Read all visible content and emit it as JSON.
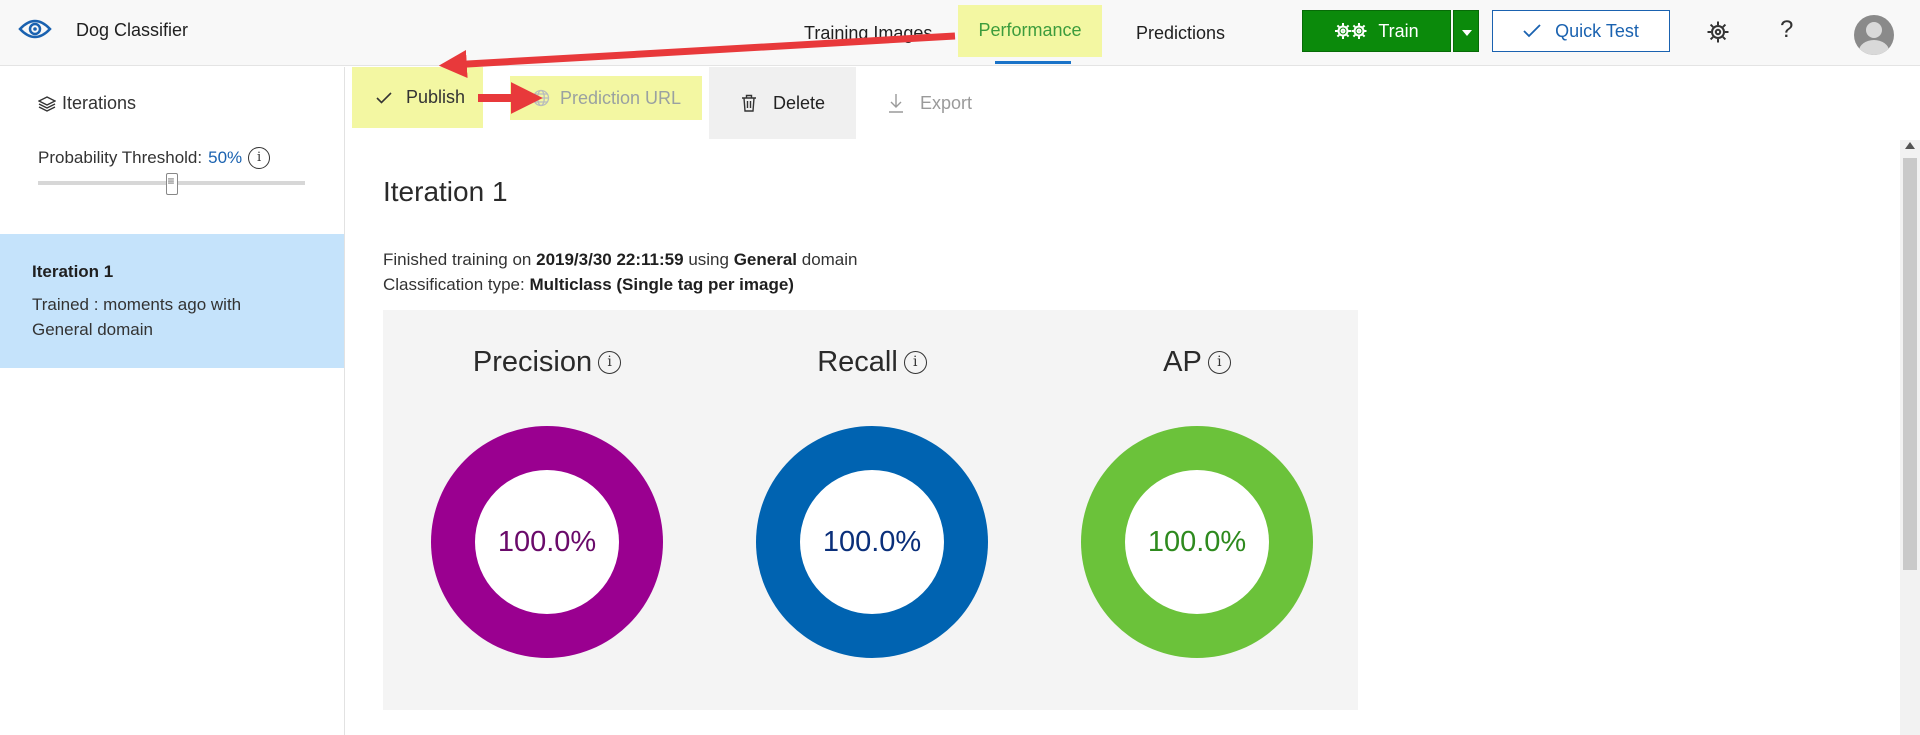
{
  "app": {
    "title": "Dog Classifier"
  },
  "nav": {
    "items": [
      {
        "label": "Training Images"
      },
      {
        "label": "Performance"
      },
      {
        "label": "Predictions"
      }
    ]
  },
  "actions": {
    "train_label": "Train",
    "quick_test_label": "Quick Test",
    "help_label": "?"
  },
  "sidebar": {
    "iterations_label": "Iterations",
    "threshold_label": "Probability Threshold:",
    "threshold_value": "50%",
    "threshold_fraction": 0.5,
    "iteration_card": {
      "title": "Iteration 1",
      "subtitle": "Trained : moments ago with General domain"
    }
  },
  "toolbar": {
    "publish_label": "Publish",
    "prediction_url_label": "Prediction URL",
    "delete_label": "Delete",
    "export_label": "Export"
  },
  "main": {
    "title": "Iteration 1",
    "finished_prefix": "Finished training on",
    "finished_date": "2019/3/30 22:11:59",
    "finished_using": "using",
    "domain": "General",
    "domain_suffix": "domain",
    "classification_prefix": "Classification type:",
    "classification_value": "Multiclass (Single tag per image)"
  },
  "metrics": [
    {
      "label": "Precision",
      "value": "100.0%",
      "ring_color": "#9a0090",
      "text_color": "#6a0a6a"
    },
    {
      "label": "Recall",
      "value": "100.0%",
      "ring_color": "#0063b1",
      "text_color": "#0a2f7a"
    },
    {
      "label": "AP",
      "value": "100.0%",
      "ring_color": "#6bc23a",
      "text_color": "#2e8a1e"
    }
  ],
  "colors": {
    "highlight": "#f3f7a2",
    "train_green": "#0b8a0b",
    "accent_blue": "#1a62b0",
    "selected_card": "#c5e3fb",
    "annotation_arrow": "#e8393b"
  }
}
